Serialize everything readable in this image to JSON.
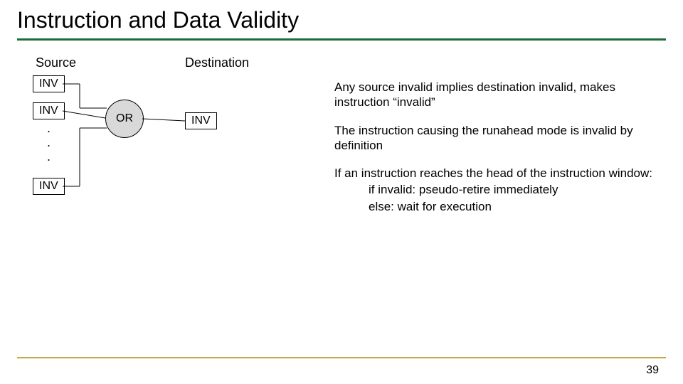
{
  "title": "Instruction and Data Validity",
  "labels": {
    "source": "Source",
    "destination": "Destination"
  },
  "nodes": {
    "source_boxes": [
      "INV",
      "INV",
      "INV"
    ],
    "dots": ".\n.\n.",
    "gate": "OR",
    "dest_box": "INV"
  },
  "body": {
    "p1": "Any source invalid implies destination invalid, makes instruction “invalid”",
    "p2": "The instruction causing the runahead mode is invalid by definition",
    "p3_lead": "If an instruction reaches the head of the instruction window:",
    "p3_a": "if invalid: pseudo-retire immediately",
    "p3_b": "else: wait for execution"
  },
  "page_number": "39",
  "colors": {
    "title_underline": "#1d6b3a",
    "footer_rule": "#c7a84b",
    "gate_fill": "#d9d9d9"
  }
}
